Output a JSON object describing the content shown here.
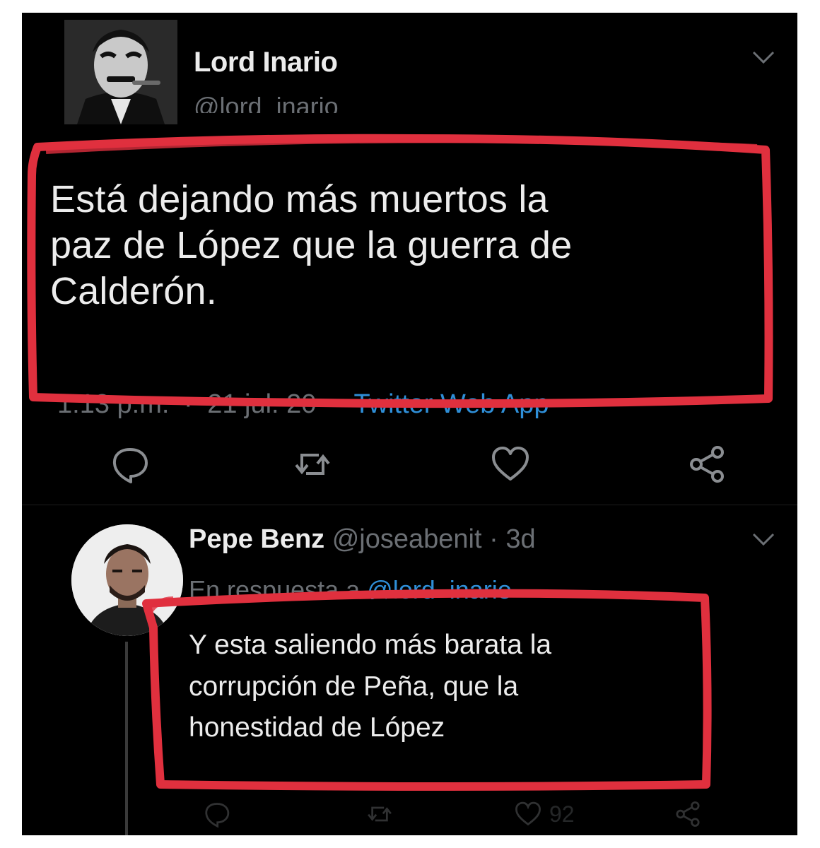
{
  "tweet": {
    "author_name": "Lord Inario",
    "author_handle": "@lord_inario",
    "text_lines": [
      "Está dejando más muertos la",
      "paz de López que la guerra de",
      "Calderón."
    ],
    "time": "1:13 p.m.",
    "date": "21 jul. 20",
    "separator": "·",
    "source": "Twitter Web App",
    "actions": {
      "reply_icon": "reply-icon",
      "retweet_icon": "retweet-icon",
      "like_icon": "heart-icon",
      "share_icon": "share-icon"
    }
  },
  "reply": {
    "author_name": "Pepe Benz",
    "author_handle": "@joseabenit",
    "separator": "·",
    "age": "3d",
    "reply_to_label": "En respuesta a",
    "reply_to_handle": "@lord_inario",
    "text_lines": [
      "Y esta saliendo más barata la",
      "corrupción de Peña, que la",
      "honestidad de López"
    ],
    "like_count": "92"
  },
  "colors": {
    "background": "#000000",
    "text": "#ececec",
    "muted": "#6b6f74",
    "link": "#2f8fd8",
    "annotation": "#e0303e"
  }
}
